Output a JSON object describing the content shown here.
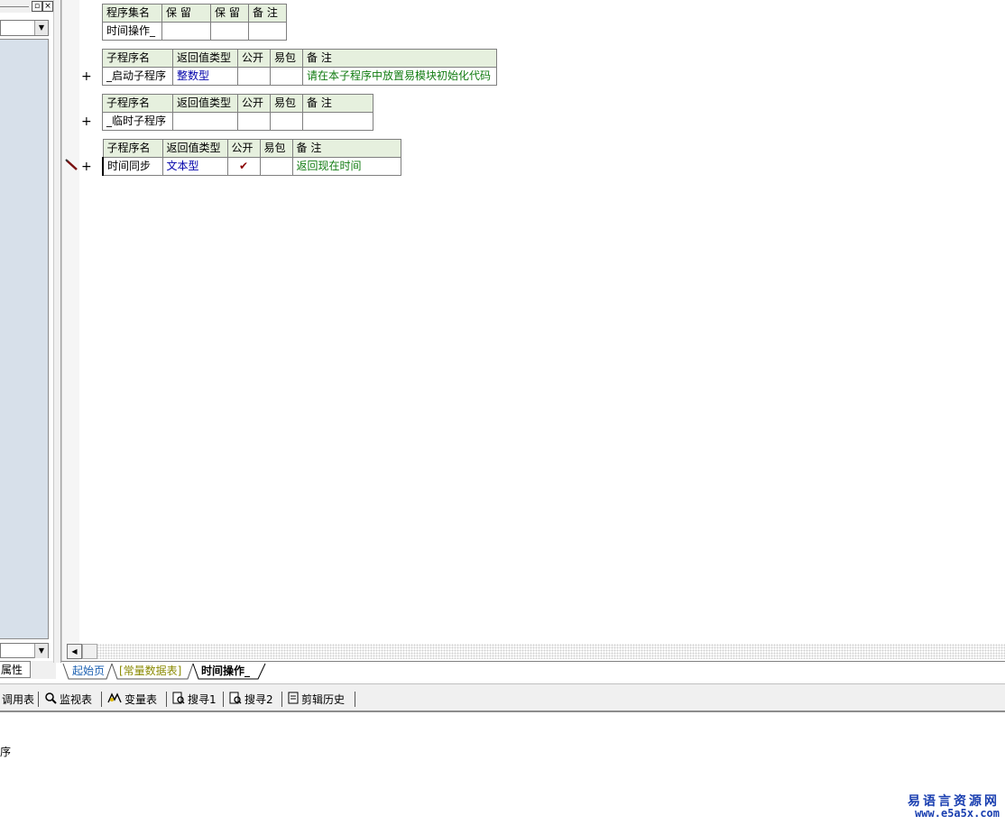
{
  "assembly_table": {
    "headers": [
      "程序集名",
      "保 留",
      "保 留",
      "备 注"
    ],
    "row": [
      "时间操作_",
      "",
      "",
      ""
    ]
  },
  "subs": [
    {
      "headers": [
        "子程序名",
        "返回值类型",
        "公开",
        "易包",
        "备 注"
      ],
      "row": {
        "name": "_启动子程序",
        "type": "整数型",
        "public": "",
        "epkg": "",
        "note": "请在本子程序中放置易模块初始化代码"
      }
    },
    {
      "headers": [
        "子程序名",
        "返回值类型",
        "公开",
        "易包",
        "备 注"
      ],
      "row": {
        "name": "_临时子程序",
        "type": "",
        "public": "",
        "epkg": "",
        "note": ""
      }
    },
    {
      "headers": [
        "子程序名",
        "返回值类型",
        "公开",
        "易包",
        "备 注"
      ],
      "row": {
        "name": "时间同步",
        "type": "文本型",
        "public": "✔",
        "epkg": "",
        "note": "返回现在时间"
      }
    }
  ],
  "expand_symbol": "+",
  "left_panel": {
    "tab_label": "属性"
  },
  "doc_tabs": [
    "起始页",
    "[常量数据表]",
    "时间操作_"
  ],
  "toolbar": [
    "调用表",
    "监视表",
    "变量表",
    "搜寻1",
    "搜寻2",
    "剪辑历史"
  ],
  "output": {
    "text": "序"
  },
  "watermark": {
    "line1": "易语言资源网",
    "line2": "www.e5a5x.com"
  },
  "colors": {
    "header_bg": "#e6f0de",
    "type_blue": "#0000aa",
    "note_green": "#107b10",
    "left_list_bg": "#d7e0ea"
  }
}
